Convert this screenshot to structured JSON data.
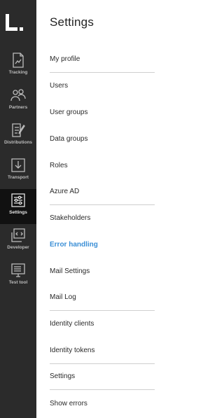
{
  "sidebar": {
    "items": [
      {
        "label": "Tracking",
        "icon": "document-icon"
      },
      {
        "label": "Partners",
        "icon": "people-icon"
      },
      {
        "label": "Distributions",
        "icon": "edit-document-icon"
      },
      {
        "label": "Transport",
        "icon": "download-tray-icon"
      },
      {
        "label": "Settings",
        "icon": "sliders-icon",
        "active": true
      },
      {
        "label": "Developer",
        "icon": "code-window-icon"
      },
      {
        "label": "Test tool",
        "icon": "monitor-icon"
      }
    ]
  },
  "panel": {
    "title": "Settings",
    "items": [
      {
        "label": "My profile"
      },
      {
        "label": "Users"
      },
      {
        "label": "User groups"
      },
      {
        "label": "Data groups"
      },
      {
        "label": "Roles"
      },
      {
        "label": "Azure AD"
      },
      {
        "label": "Stakeholders"
      },
      {
        "label": "Error handling",
        "active": true
      },
      {
        "label": "Mail Settings"
      },
      {
        "label": "Mail Log"
      },
      {
        "label": "Identity clients"
      },
      {
        "label": "Identity tokens"
      },
      {
        "label": "Settings"
      },
      {
        "label": "Show errors"
      }
    ]
  },
  "colors": {
    "rail": "#2b2b2b",
    "active_rail": "#111111",
    "accent": "#3b8fd6"
  }
}
